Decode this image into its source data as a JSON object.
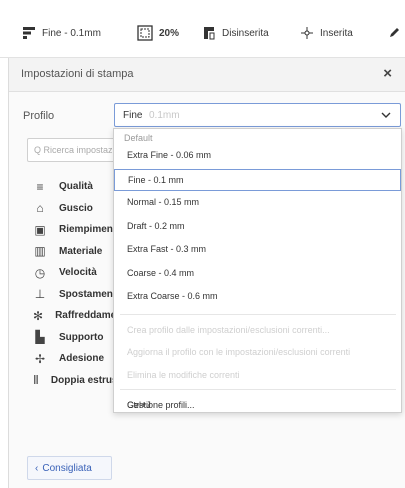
{
  "toolbar": {
    "profile_label": "Fine - 0.1mm",
    "infill_label": "20%",
    "support_label": "Disinserita",
    "adhesion_label": "Inserita"
  },
  "panel": {
    "title": "Impostazioni di stampa",
    "close_glyph": "×",
    "profile_label": "Profilo",
    "profile_value": "Fine",
    "profile_hint": "0.1mm",
    "search_placeholder": "Q Ricerca impostazioni"
  },
  "settings": [
    {
      "icon": "quality-icon",
      "label": "Qualità"
    },
    {
      "icon": "shell-icon",
      "label": "Guscio"
    },
    {
      "icon": "infill-icon",
      "label": "Riempimento"
    },
    {
      "icon": "material-icon",
      "label": "Materiale"
    },
    {
      "icon": "speed-icon",
      "label": "Velocità"
    },
    {
      "icon": "travel-icon",
      "label": "Spostamenti"
    },
    {
      "icon": "cooling-icon",
      "label": "Raffreddamento"
    },
    {
      "icon": "support-icon",
      "label": "Supporto"
    },
    {
      "icon": "adhesion-icon",
      "label": "Adesione"
    },
    {
      "icon": "dual-extrusion-icon",
      "label": "Doppia estrusione"
    }
  ],
  "dropdown": {
    "header": "Default",
    "profiles": [
      "Extra Fine - 0.06 mm",
      "Fine - 0.1 mm",
      "Normal - 0.15 mm",
      "Draft - 0.2 mm",
      "Extra Fast - 0.3 mm",
      "Coarse - 0.4 mm",
      "Extra Coarse - 0.6 mm"
    ],
    "selected_index": 1,
    "actions": [
      "Crea profilo dalle impostazioni/esclusioni correnti...",
      "Aggiorna il profilo con le impostazioni/esclusioni correnti",
      "Elimina le modifiche correnti"
    ],
    "manage_label": "Gestione profili...",
    "manage_shortcut": "Ctrl+J"
  },
  "footer": {
    "recommended_label": "Consigliata",
    "back_glyph": "‹"
  },
  "colors": {
    "accent": "#3a62b8",
    "selected_border": "#7a9bd8"
  }
}
